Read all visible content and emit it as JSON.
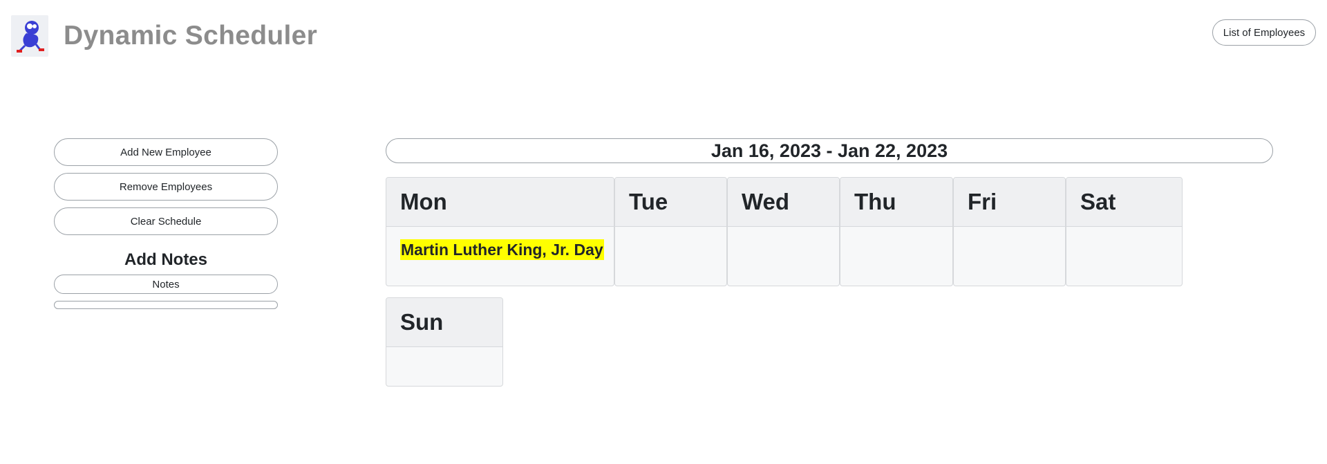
{
  "header": {
    "app_title": "Dynamic Scheduler",
    "employees_button": "List of Employees"
  },
  "sidebar": {
    "add_employee": "Add New Employee",
    "remove_employees": "Remove Employees",
    "clear_schedule": "Clear Schedule",
    "notes_heading": "Add Notes",
    "notes_placeholder": "Notes"
  },
  "schedule": {
    "week_range": "Jan 16, 2023 - Jan 22, 2023",
    "days": [
      {
        "name": "Mon",
        "note": "Martin Luther King, Jr. Day"
      },
      {
        "name": "Tue"
      },
      {
        "name": "Wed"
      },
      {
        "name": "Thu"
      },
      {
        "name": "Fri"
      },
      {
        "name": "Sat"
      },
      {
        "name": "Sun"
      }
    ]
  },
  "colors": {
    "holiday_highlight": "#ffff00",
    "title_gray": "#8c8c8c"
  }
}
